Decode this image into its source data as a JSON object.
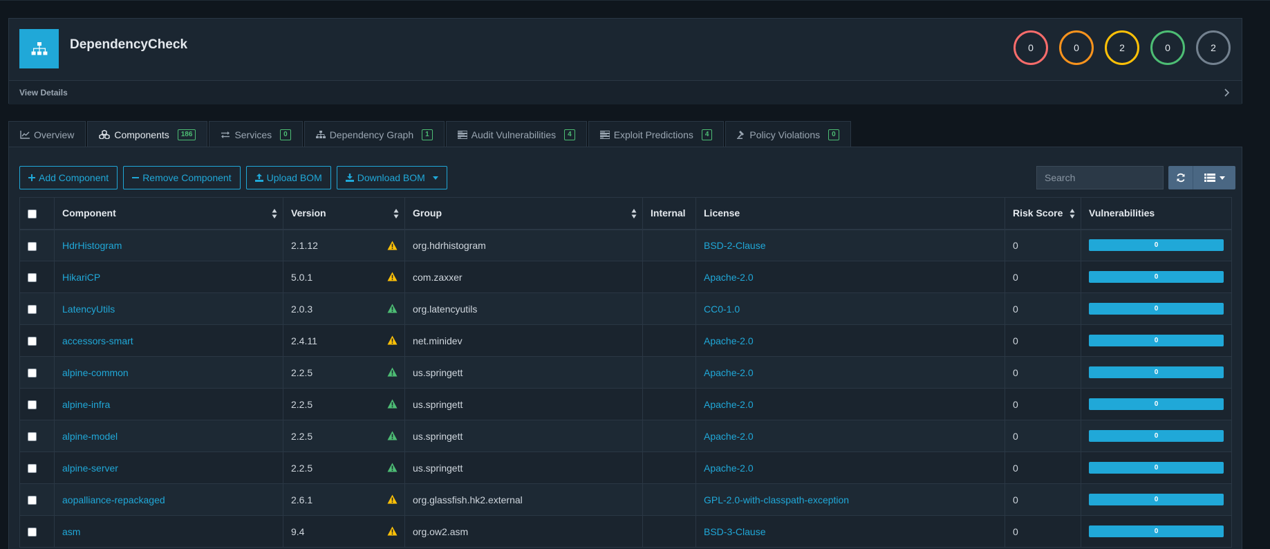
{
  "project": {
    "name": "DependencyCheck",
    "view_details": "View Details",
    "severity": [
      {
        "count": "0",
        "color": "#f86c6b",
        "level": "critical"
      },
      {
        "count": "0",
        "color": "#f8931d",
        "level": "high"
      },
      {
        "count": "2",
        "color": "#ffc107",
        "level": "medium"
      },
      {
        "count": "0",
        "color": "#4dbd74",
        "level": "low"
      },
      {
        "count": "2",
        "color": "#73818f",
        "level": "unassigned"
      }
    ]
  },
  "tabs": [
    {
      "label": "Overview",
      "icon": "line-chart-icon",
      "badge": null
    },
    {
      "label": "Components",
      "icon": "cubes-icon",
      "badge": "186",
      "active": true
    },
    {
      "label": "Services",
      "icon": "exchange-icon",
      "badge": "0"
    },
    {
      "label": "Dependency Graph",
      "icon": "sitemap-icon",
      "badge": "1"
    },
    {
      "label": "Audit Vulnerabilities",
      "icon": "tasks-icon",
      "badge": "4"
    },
    {
      "label": "Exploit Predictions",
      "icon": "tasks-icon",
      "badge": "4"
    },
    {
      "label": "Policy Violations",
      "icon": "gavel-icon",
      "badge": "0"
    }
  ],
  "toolbar": {
    "add_component": "Add Component",
    "remove_component": "Remove Component",
    "upload_bom": "Upload BOM",
    "download_bom": "Download BOM",
    "search_placeholder": "Search"
  },
  "columns": {
    "component": "Component",
    "version": "Version",
    "group": "Group",
    "internal": "Internal",
    "license": "License",
    "risk_score": "Risk Score",
    "vulnerabilities": "Vulnerabilities"
  },
  "colors": {
    "accent": "#20a8d8",
    "warn_yellow": "#ffc107",
    "ok_green": "#4dbd74"
  },
  "rows": [
    {
      "component": "HdrHistogram",
      "version": "2.1.12",
      "status": "outdated",
      "group": "org.hdrhistogram",
      "internal": "",
      "license": "BSD-2-Clause",
      "risk": "0",
      "vulns": "0"
    },
    {
      "component": "HikariCP",
      "version": "5.0.1",
      "status": "outdated",
      "group": "com.zaxxer",
      "internal": "",
      "license": "Apache-2.0",
      "risk": "0",
      "vulns": "0"
    },
    {
      "component": "LatencyUtils",
      "version": "2.0.3",
      "status": "current",
      "group": "org.latencyutils",
      "internal": "",
      "license": "CC0-1.0",
      "risk": "0",
      "vulns": "0"
    },
    {
      "component": "accessors-smart",
      "version": "2.4.11",
      "status": "outdated",
      "group": "net.minidev",
      "internal": "",
      "license": "Apache-2.0",
      "risk": "0",
      "vulns": "0"
    },
    {
      "component": "alpine-common",
      "version": "2.2.5",
      "status": "current",
      "group": "us.springett",
      "internal": "",
      "license": "Apache-2.0",
      "risk": "0",
      "vulns": "0"
    },
    {
      "component": "alpine-infra",
      "version": "2.2.5",
      "status": "current",
      "group": "us.springett",
      "internal": "",
      "license": "Apache-2.0",
      "risk": "0",
      "vulns": "0"
    },
    {
      "component": "alpine-model",
      "version": "2.2.5",
      "status": "current",
      "group": "us.springett",
      "internal": "",
      "license": "Apache-2.0",
      "risk": "0",
      "vulns": "0"
    },
    {
      "component": "alpine-server",
      "version": "2.2.5",
      "status": "current",
      "group": "us.springett",
      "internal": "",
      "license": "Apache-2.0",
      "risk": "0",
      "vulns": "0"
    },
    {
      "component": "aopalliance-repackaged",
      "version": "2.6.1",
      "status": "outdated",
      "group": "org.glassfish.hk2.external",
      "internal": "",
      "license": "GPL-2.0-with-classpath-exception",
      "risk": "0",
      "vulns": "0"
    },
    {
      "component": "asm",
      "version": "9.4",
      "status": "outdated",
      "group": "org.ow2.asm",
      "internal": "",
      "license": "BSD-3-Clause",
      "risk": "0",
      "vulns": "0"
    }
  ]
}
